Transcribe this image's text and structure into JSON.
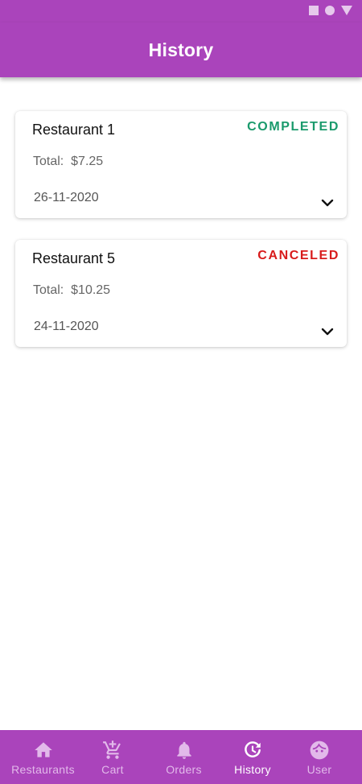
{
  "app_bar": {
    "title": "History"
  },
  "orders": [
    {
      "restaurant": "Restaurant 1",
      "status": "COMPLETED",
      "total_label": "Total:",
      "total_value": "$7.25",
      "date": "26-11-2020"
    },
    {
      "restaurant": "Restaurant 5",
      "status": "CANCELED",
      "total_label": "Total:",
      "total_value": "$10.25",
      "date": "24-11-2020"
    }
  ],
  "bottom_nav": {
    "items": [
      {
        "label": "Restaurants",
        "icon": "home-icon",
        "active": false
      },
      {
        "label": "Cart",
        "icon": "cart-add-icon",
        "active": false
      },
      {
        "label": "Orders",
        "icon": "bell-icon",
        "active": false
      },
      {
        "label": "History",
        "icon": "refresh-icon",
        "active": true
      },
      {
        "label": "User",
        "icon": "face-icon",
        "active": false
      }
    ]
  },
  "colors": {
    "primary": "#aa44bb",
    "completed": "#1a9a6c",
    "canceled": "#d81b1b",
    "nav_inactive": "#e2b9ea",
    "nav_active": "#ffffff"
  }
}
